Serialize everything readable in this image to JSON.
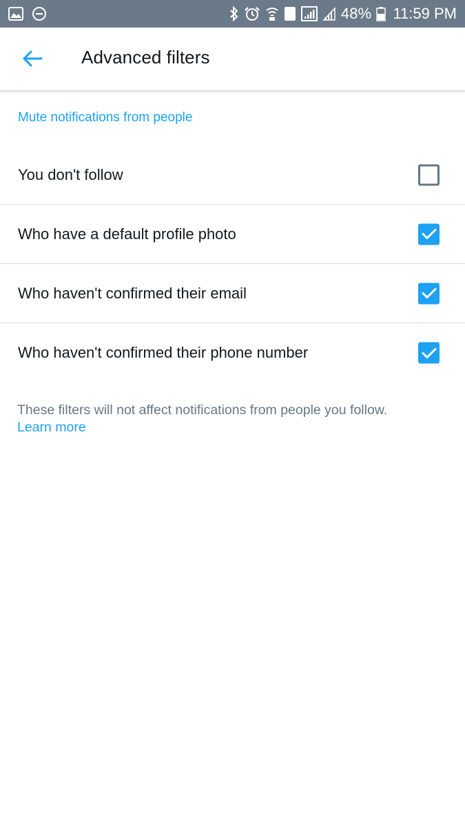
{
  "status_bar": {
    "battery_percent": "48%",
    "time": "11:59 PM",
    "sim_slot": "1",
    "left_icons": [
      "gallery-icon",
      "do-not-disturb-icon"
    ],
    "right_icons": [
      "bluetooth-icon",
      "alarm-icon",
      "wifi-icon",
      "sim-icon",
      "signal-icon",
      "signal-icon",
      "battery-icon"
    ]
  },
  "header": {
    "title": "Advanced filters",
    "back_icon": "arrow-left-icon"
  },
  "section": {
    "title": "Mute notifications from people"
  },
  "filters": [
    {
      "label": "You don't follow",
      "checked": false
    },
    {
      "label": "Who have a default profile photo",
      "checked": true
    },
    {
      "label": "Who haven't confirmed their email",
      "checked": true
    },
    {
      "label": "Who haven't confirmed their phone number",
      "checked": true
    }
  ],
  "footnote": {
    "text": "These filters will not affect notifications from people you follow.",
    "link_label": "Learn more"
  },
  "colors": {
    "accent": "#1da1f2",
    "status_bar": "#6b7a88",
    "secondary_text": "#657786",
    "primary_text": "#14171a"
  }
}
